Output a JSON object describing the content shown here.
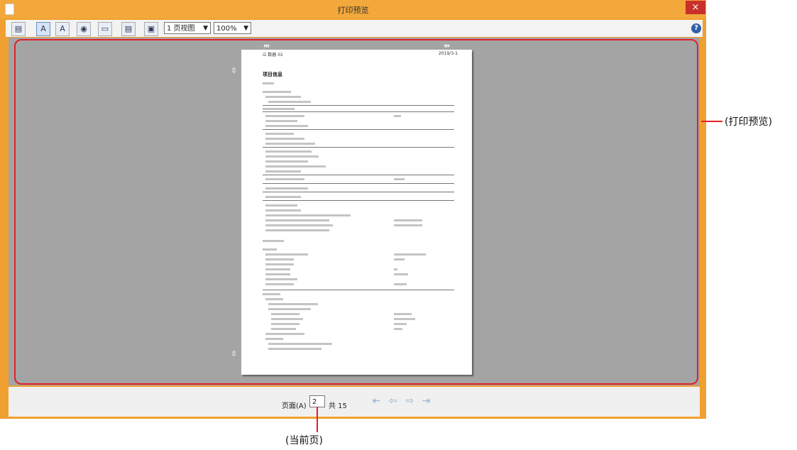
{
  "window": {
    "title": "打印预览",
    "close_symbol": "×"
  },
  "toolbar": {
    "view_select": "1 页视图",
    "zoom_select": "100%",
    "help_symbol": "?"
  },
  "page_preview": {
    "header_left": "☑ 数器 01",
    "header_right": "2019/3-1",
    "title": "项目信息"
  },
  "statusbar": {
    "page_label": "页面(A)",
    "current_page": "2",
    "total_label": "共 15"
  },
  "callouts": {
    "preview": "(打印预览)",
    "current_page": "(当前页)"
  }
}
